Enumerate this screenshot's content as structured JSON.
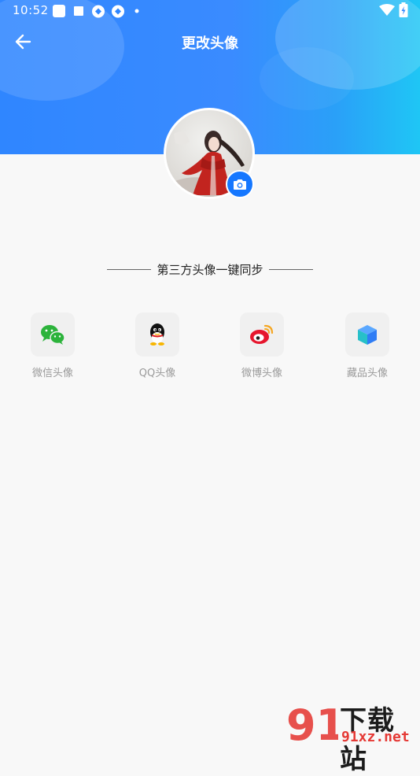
{
  "status_bar": {
    "time": "10:52",
    "icons": [
      "square-notification-icon",
      "stop-icon",
      "network-icon",
      "network-icon",
      "dot-icon",
      "wifi-icon",
      "battery-icon"
    ]
  },
  "nav": {
    "back_icon": "arrow-left-icon",
    "title": "更改头像"
  },
  "avatar": {
    "camera_icon": "camera-icon"
  },
  "third_party": {
    "section_title": "第三方头像一键同步",
    "items": [
      {
        "label": "微信头像",
        "icon": "wechat-icon",
        "color": "#2cb33b"
      },
      {
        "label": "QQ头像",
        "icon": "qq-penguin-icon",
        "color": "#000000"
      },
      {
        "label": "微博头像",
        "icon": "weibo-icon",
        "color": "#e6162d"
      },
      {
        "label": "藏品头像",
        "icon": "cube-icon",
        "color": "#3aa0ff"
      }
    ]
  },
  "watermark": {
    "logo_number": "91",
    "text": "下载站",
    "url": "91xz.net"
  },
  "colors": {
    "header_blue": "#2f86ff",
    "header_cyan": "#1fc6f5",
    "camera_button": "#1577ff",
    "page_background": "#f8f8f8"
  }
}
